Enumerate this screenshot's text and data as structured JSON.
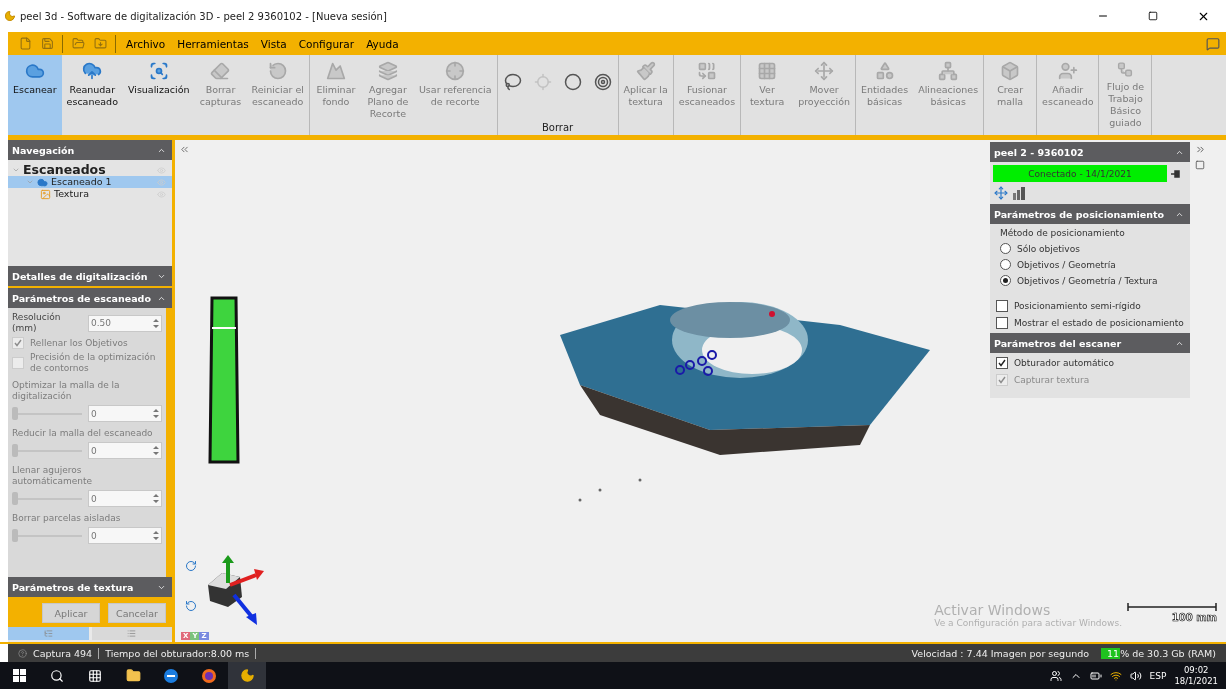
{
  "window": {
    "title": "peel 3d - Software de digitalización 3D - peel 2 9360102 - [Nueva sesión]"
  },
  "menu": [
    "Archivo",
    "Herramientas",
    "Vista",
    "Configurar",
    "Ayuda"
  ],
  "ribbon": {
    "groups": [
      {
        "buttons": [
          {
            "kind": "scan",
            "label": "Escanear",
            "selected": true,
            "disabled": false
          },
          {
            "kind": "resume",
            "label": "Reanudar\nescaneado",
            "selected": false,
            "disabled": false
          },
          {
            "kind": "view",
            "label": "Visualización",
            "selected": false,
            "disabled": false
          },
          {
            "kind": "erase",
            "label": "Borrar\ncapturas",
            "selected": false,
            "disabled": true
          },
          {
            "kind": "reset",
            "label": "Reiniciar el\nescaneado",
            "selected": false,
            "disabled": true
          }
        ]
      },
      {
        "buttons": [
          {
            "kind": "background",
            "label": "Eliminar\nfondo",
            "selected": false,
            "disabled": true
          },
          {
            "kind": "plane",
            "label": "Agregar\nPlano de\nRecorte",
            "selected": false,
            "disabled": true
          },
          {
            "kind": "reference",
            "label": "Usar referencia\nde recorte",
            "selected": false,
            "disabled": true
          }
        ]
      },
      {
        "title": "Borrar",
        "buttons": [
          {
            "kind": "lasso",
            "disabled": false
          },
          {
            "kind": "point",
            "disabled": true
          },
          {
            "kind": "circle",
            "disabled": false
          },
          {
            "kind": "target",
            "disabled": false
          }
        ]
      },
      {
        "buttons": [
          {
            "kind": "apply",
            "label": "Aplicar la\ntextura",
            "selected": false,
            "disabled": true
          }
        ]
      },
      {
        "buttons": [
          {
            "kind": "merge",
            "label": "Fusionar\nescaneados",
            "selected": false,
            "disabled": true
          }
        ]
      },
      {
        "buttons": [
          {
            "kind": "texture",
            "label": "Ver\ntextura",
            "selected": false,
            "disabled": true
          },
          {
            "kind": "move",
            "label": "Mover\nproyección",
            "selected": false,
            "disabled": true
          }
        ]
      },
      {
        "buttons": [
          {
            "kind": "entities",
            "label": "Entidades\nbásicas",
            "selected": false,
            "disabled": true
          },
          {
            "kind": "alignments",
            "label": "Alineaciones\nbásicas",
            "selected": false,
            "disabled": true
          }
        ]
      },
      {
        "buttons": [
          {
            "kind": "mesh",
            "label": "Crear\nmalla",
            "selected": false,
            "disabled": true
          }
        ]
      },
      {
        "buttons": [
          {
            "kind": "add",
            "label": "Añadir\nescaneado",
            "selected": false,
            "disabled": true
          }
        ]
      },
      {
        "buttons": [
          {
            "kind": "workflow",
            "label": "Flujo de\nTrabajo\nBásico\nguiado",
            "selected": false,
            "disabled": true
          }
        ]
      }
    ]
  },
  "navigation": {
    "title": "Navegación",
    "tree": [
      {
        "label": "Escaneados",
        "expanded": true,
        "selected": false,
        "children": [
          {
            "label": "Escaneado 1",
            "expanded": true,
            "selected": true,
            "children": [
              {
                "label": "Textura",
                "selected": false
              }
            ]
          }
        ]
      }
    ]
  },
  "scan_panel": {
    "sections": [
      {
        "title": "Detalles de digitalización",
        "expanded": false
      },
      {
        "title": "Parámetros de escaneado",
        "expanded": true
      },
      {
        "title": "Parámetros de textura",
        "expanded": false
      }
    ],
    "resolution": {
      "label": "Resolución\n(mm)",
      "value": "0.50"
    },
    "options": [
      {
        "label": "Rellenar los Objetivos",
        "checked": true,
        "disabled": true
      },
      {
        "label": "Precisión de la optimización de contornos",
        "checked": false,
        "disabled": true
      }
    ],
    "sliders": [
      {
        "label": "Optimizar la malla de la digitalización",
        "value": "0",
        "level": 0
      },
      {
        "label": "Reducir la malla del escaneado",
        "value": "0",
        "level": 0
      },
      {
        "label": "Llenar agujeros automáticamente",
        "value": "0",
        "level": 0
      },
      {
        "label": "Borrar parcelas aisladas",
        "value": "0",
        "level": 0
      }
    ],
    "buttons": [
      "Aplicar",
      "Cancelar"
    ],
    "tabs": [
      {
        "kind": "tree",
        "selected": true
      },
      {
        "kind": "list",
        "selected": false
      }
    ]
  },
  "viewport": {
    "axis_labels": [
      "X",
      "Y",
      "Z"
    ],
    "scale": "100 mm",
    "activation": {
      "title": "Activar Windows",
      "text": "Ve a Configuración para activar Windows."
    }
  },
  "device_panel": {
    "title": "peel 2 - 9360102",
    "status": "Conectado - 14/1/2021",
    "connected": true,
    "positioning": {
      "title": "Parámetros de posicionamiento",
      "expanded": true,
      "method_label": "Método de posicionamiento",
      "methods": [
        {
          "label": "Sólo objetivos",
          "selected": false
        },
        {
          "label": "Objetivos / Geometría",
          "selected": false
        },
        {
          "label": "Objetivos / Geometría / Textura",
          "selected": true
        }
      ],
      "options": [
        {
          "label": "Posicionamiento semi-rígido",
          "checked": false,
          "disabled": false
        },
        {
          "label": "Mostrar el estado de posicionamiento",
          "checked": false,
          "disabled": false
        }
      ]
    },
    "scanner": {
      "title": "Parámetros del escaner",
      "expanded": true,
      "options": [
        {
          "label": "Obturador automático",
          "checked": true,
          "disabled": false
        },
        {
          "label": "Capturar textura",
          "checked": true,
          "disabled": true
        }
      ]
    }
  },
  "status_bar": {
    "capture": "Captura 494",
    "shutter": "Tiempo del obturador:8.00 ms",
    "speed": "Velocidad : 7.44 Imagen por segundo",
    "ram_value": "11",
    "ram_text": "% de 30.3 Gb (RAM)"
  },
  "taskbar": {
    "language": "ESP",
    "time": "09:02",
    "date": "18/1/2021"
  }
}
